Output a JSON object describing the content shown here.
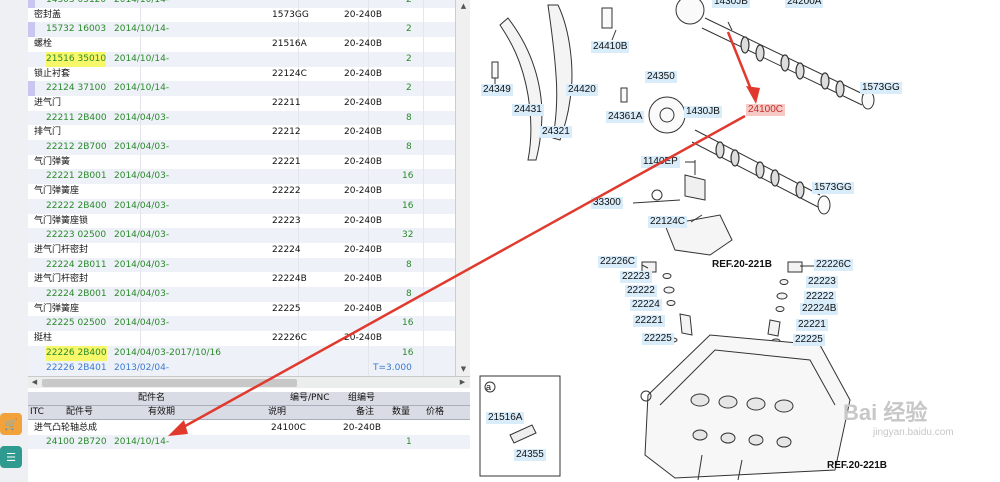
{
  "upper_table": [
    {
      "name": "",
      "part_no": "14303 05120",
      "date": "2014/10/14-",
      "qty": "2",
      "chip": true,
      "partial": true
    },
    {
      "name": "密封盖",
      "ref": "1573GG",
      "model": "20-240B"
    },
    {
      "part_no": "15732 16003",
      "date": "2014/10/14-",
      "qty": "2",
      "chip": true
    },
    {
      "name": "螺栓",
      "ref": "21516A",
      "model": "20-240B"
    },
    {
      "part_no": "21516 35010",
      "date": "2014/10/14-",
      "qty": "2",
      "highlight": true
    },
    {
      "name": "锁止衬套",
      "ref": "22124C",
      "model": "20-240B"
    },
    {
      "part_no": "22124 37100",
      "date": "2014/10/14-",
      "qty": "2",
      "chip": true
    },
    {
      "name": "进气门",
      "ref": "22211",
      "model": "20-240B"
    },
    {
      "part_no": "22211 2B400",
      "date": "2014/04/03-",
      "qty": "8"
    },
    {
      "name": "排气门",
      "ref": "22212",
      "model": "20-240B"
    },
    {
      "part_no": "22212 2B700",
      "date": "2014/04/03-",
      "qty": "8"
    },
    {
      "name": "气门弹簧",
      "ref": "22221",
      "model": "20-240B"
    },
    {
      "part_no": "22221 2B001",
      "date": "2014/04/03-",
      "qty": "16"
    },
    {
      "name": "气门弹簧座",
      "ref": "22222",
      "model": "20-240B"
    },
    {
      "part_no": "22222 2B400",
      "date": "2014/04/03-",
      "qty": "16"
    },
    {
      "name": "气门弹簧座锁",
      "ref": "22223",
      "model": "20-240B"
    },
    {
      "part_no": "22223 02500",
      "date": "2014/04/03-",
      "qty": "32"
    },
    {
      "name": "进气门杆密封",
      "ref": "22224",
      "model": "20-240B"
    },
    {
      "part_no": "22224 2B011",
      "date": "2014/04/03-",
      "qty": "8"
    },
    {
      "name": "进气门杆密封",
      "ref": "22224B",
      "model": "20-240B"
    },
    {
      "part_no": "22224 2B001",
      "date": "2014/04/03-",
      "qty": "8"
    },
    {
      "name": "气门弹簧座",
      "ref": "22225",
      "model": "20-240B"
    },
    {
      "part_no": "22225 02500",
      "date": "2014/04/03-",
      "qty": "16"
    },
    {
      "name": "挺柱",
      "ref": "22226C",
      "model": "20-240B"
    },
    {
      "part_no": "22226 2B400",
      "date": "2014/04/03-2017/10/16",
      "qty": "16",
      "highlight": true
    },
    {
      "part_no": "22226 2B401",
      "date": "2013/02/04-",
      "qty": "T=3.000",
      "blue": true,
      "partial": true
    }
  ],
  "bottom_table": {
    "header1": {
      "name": "配件名",
      "ref": "编号/PNC",
      "group": "组编号"
    },
    "header2": {
      "itc": "ITC",
      "part_no": "配件号",
      "date": "有效期",
      "desc": "说明",
      "note": "备注",
      "qty": "数量",
      "price": "价格"
    },
    "row_name": {
      "name": "进气凸轮轴总成",
      "ref": "24100C",
      "model": "20-240B"
    },
    "row_code": {
      "part_no": "24100 2B720",
      "date": "2014/10/14-",
      "qty": "1"
    }
  },
  "diagram_labels": {
    "l1430JB_top": "1430JB",
    "l24200A": "24200A",
    "l24410B": "24410B",
    "l24349": "24349",
    "l24431": "24431",
    "l24420": "24420",
    "l24321": "24321",
    "l24350": "24350",
    "l24361A": "24361A",
    "l1430JB": "1430JB",
    "l24100C": "24100C",
    "l1573GG_top": "1573GG",
    "l1140EP": "1140EP",
    "l33300": "33300",
    "l22124C": "22124C",
    "l1573GG": "1573GG",
    "l22226C_l": "22226C",
    "l22223_l": "22223",
    "l22222_l": "22222",
    "l22224_l": "22224",
    "l22221_l": "22221",
    "l22225_l": "22225",
    "l22226C_r": "22226C",
    "l22223_r": "22223",
    "l22222_r": "22222",
    "l22224B_r": "22224B",
    "l22221_r": "22221",
    "l22225_r": "22225",
    "ref_top": "REF.20-221B",
    "ref_bottom": "REF.20-221B",
    "l21516A": "21516A",
    "l24355": "24355",
    "callout_a": "a"
  },
  "watermark": {
    "text": "Bai 经验",
    "url": "jingyan.baidu.com"
  },
  "colors": {
    "arrow": "#e03a2f",
    "label_bg": "#d8ecfa",
    "highlight": "#f7f76a"
  }
}
